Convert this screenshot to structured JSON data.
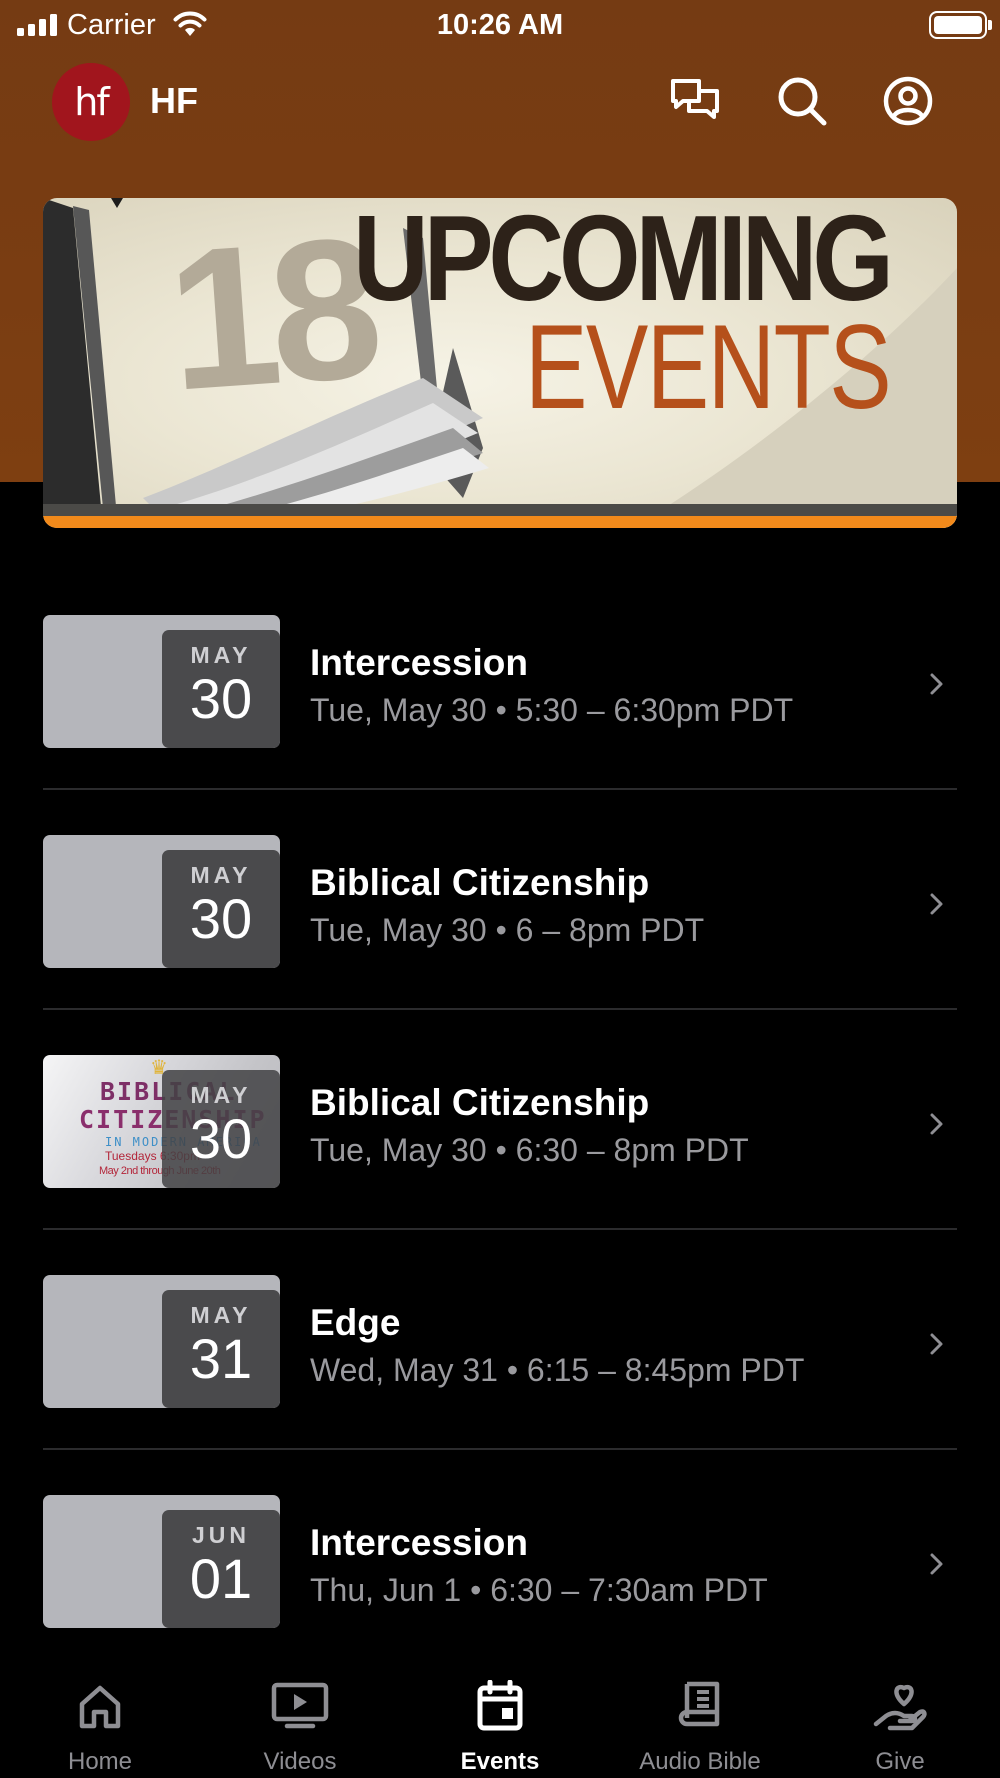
{
  "status_bar": {
    "carrier": "Carrier",
    "time": "10:26 AM"
  },
  "header": {
    "logo_text": "hf",
    "app_name": "HF",
    "icons": [
      "chat-icon",
      "search-icon",
      "profile-icon"
    ]
  },
  "banner": {
    "number": "18",
    "title": "UPCOMING",
    "subtitle": "EVENTS"
  },
  "events": [
    {
      "month": "MAY",
      "day": "30",
      "title": "Intercession",
      "when": "Tue, May 30 • 5:30 – 6:30pm PDT",
      "has_image": false
    },
    {
      "month": "MAY",
      "day": "30",
      "title": "Biblical Citizenship",
      "when": "Tue, May 30 • 6 – 8pm PDT",
      "has_image": false
    },
    {
      "month": "MAY",
      "day": "30",
      "title": "Biblical Citizenship",
      "when": "Tue, May 30 • 6:30 – 8pm PDT",
      "has_image": true,
      "poster": {
        "line1": "BIBLICAL",
        "line2": "CITIZENSHIP",
        "line3": "IN MODERN AMERICA",
        "line4": "Tuesdays 6:30pm",
        "line5": "May 2nd through June 20th"
      }
    },
    {
      "month": "MAY",
      "day": "31",
      "title": "Edge",
      "when": "Wed, May 31 • 6:15 – 8:45pm PDT",
      "has_image": false
    },
    {
      "month": "JUN",
      "day": "01",
      "title": "Intercession",
      "when": "Thu, Jun 1 • 6:30 – 7:30am PDT",
      "has_image": false
    }
  ],
  "tab_bar": {
    "tabs": [
      {
        "label": "Home",
        "icon": "home-icon",
        "active": false
      },
      {
        "label": "Videos",
        "icon": "video-icon",
        "active": false
      },
      {
        "label": "Events",
        "icon": "calendar-icon",
        "active": true
      },
      {
        "label": "Audio Bible",
        "icon": "bible-icon",
        "active": false
      },
      {
        "label": "Give",
        "icon": "give-heart-icon",
        "active": false
      }
    ]
  },
  "colors": {
    "header_brown": "#7a3d12",
    "logo_red": "#a1151d",
    "banner_orange": "#f28a1b",
    "date_box": "#4a4a4c",
    "thumb_gray": "#b5b6bb"
  }
}
